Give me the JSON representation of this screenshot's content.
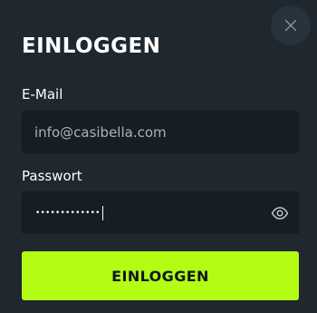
{
  "modal": {
    "title": "EINLOGGEN",
    "close_icon": "close-icon"
  },
  "email": {
    "label": "E-Mail",
    "placeholder": "info@casibella.com",
    "value": ""
  },
  "password": {
    "label": "Passwort",
    "masked_value": "•••••••••••••",
    "toggle_icon": "eye-icon"
  },
  "submit": {
    "label": "EINLOGGEN"
  },
  "colors": {
    "background": "#1f272f",
    "input_background": "#161d24",
    "accent": "#b3fc14",
    "close_button_background": "#28323c"
  }
}
